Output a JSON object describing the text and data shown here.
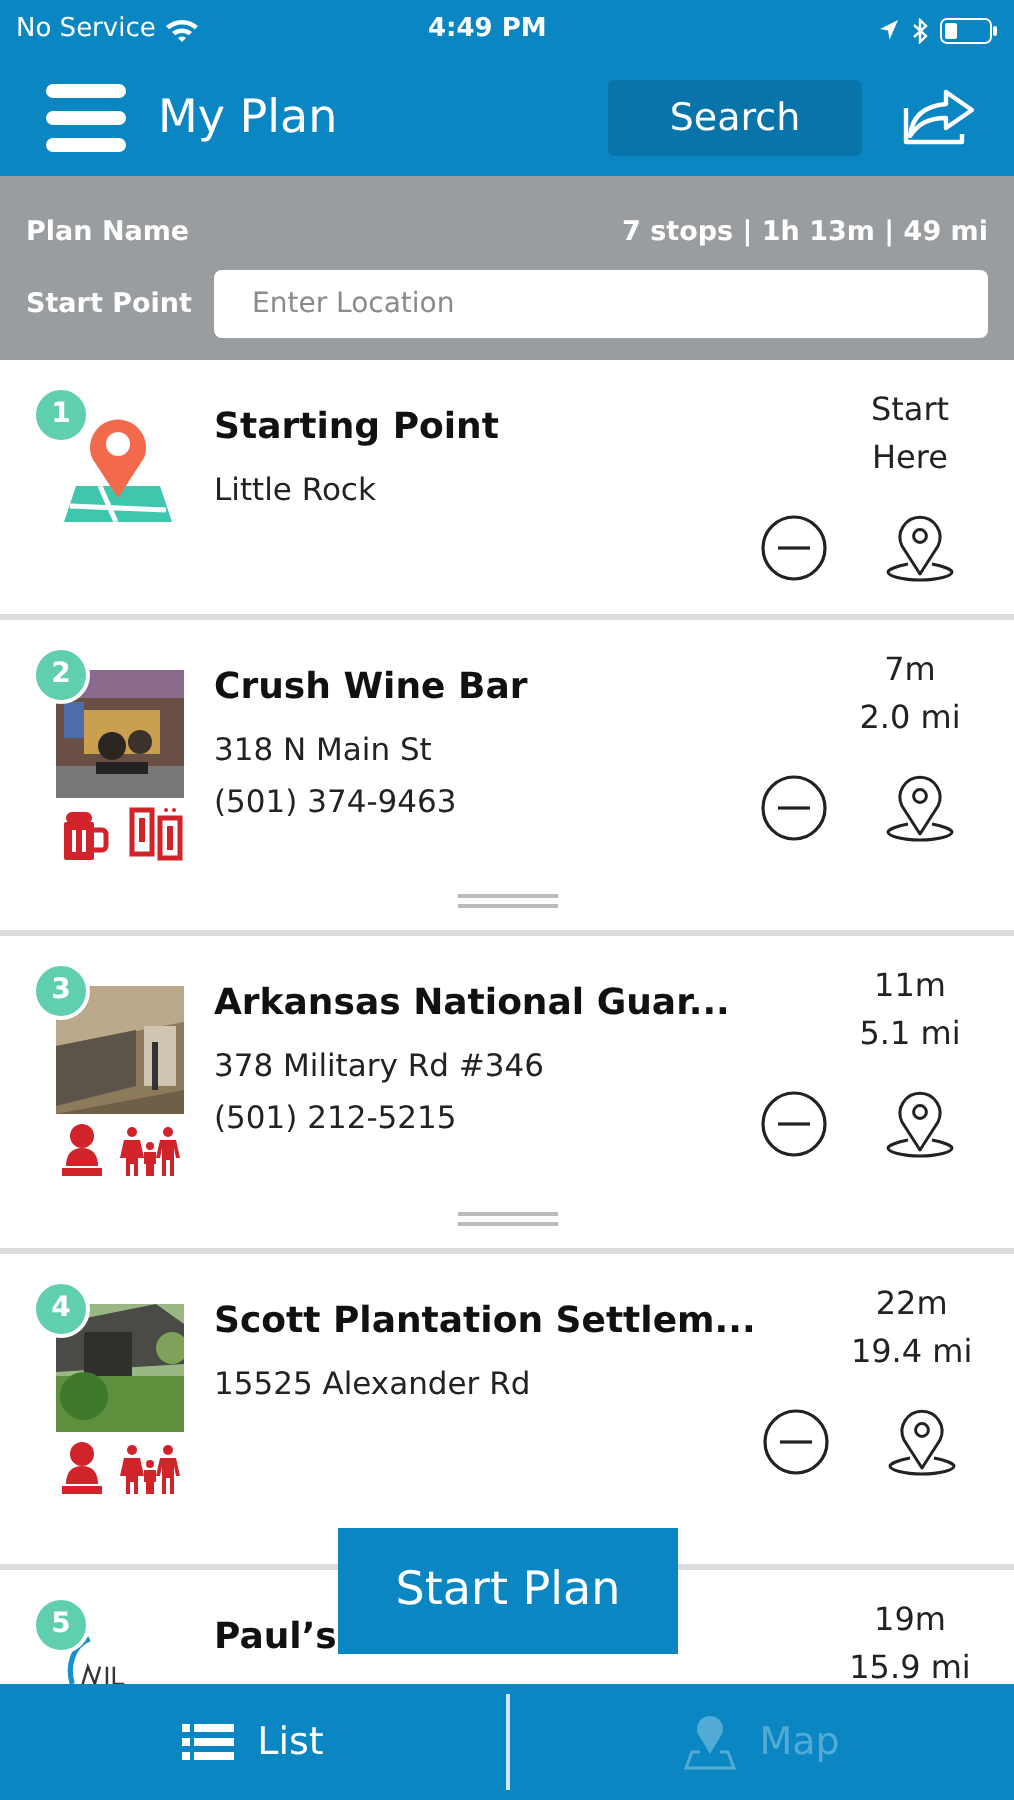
{
  "status_bar": {
    "carrier": "No Service",
    "time": "4:49 PM"
  },
  "header": {
    "title": "My Plan",
    "search_label": "Search"
  },
  "plan": {
    "name_label": "Plan Name",
    "summary": "7 stops | 1h 13m | 49 mi",
    "start_label": "Start Point",
    "start_field": {
      "placeholder": "Enter Location"
    }
  },
  "stops": [
    {
      "number": "1",
      "kind": "start",
      "name": "Starting Point",
      "lines": [
        "Little Rock"
      ],
      "times": [
        "Start",
        "Here"
      ],
      "drag_handle": false
    },
    {
      "number": "2",
      "kind": "place",
      "name": "Crush Wine Bar",
      "lines": [
        "318 N Main St",
        "(501) 374-9463"
      ],
      "times": [
        "7m",
        "2.0 mi"
      ],
      "amenities": [
        {
          "kind": "beer"
        },
        {
          "kind": "drinks"
        }
      ],
      "drag_handle": true,
      "picture": {
        "kind": "picture"
      }
    },
    {
      "number": "3",
      "kind": "place",
      "name": "Arkansas National Guar...",
      "lines": [
        "378 Military Rd #346",
        "(501) 212-5215"
      ],
      "times": [
        "11m",
        "5.1 mi"
      ],
      "amenities": [
        {
          "kind": "museum"
        },
        {
          "kind": "family"
        }
      ],
      "drag_handle": true,
      "picture": {
        "kind": "picture"
      }
    },
    {
      "number": "4",
      "kind": "place",
      "name": "Scott Plantation Settlem...",
      "lines": [
        "15525 Alexander Rd"
      ],
      "times": [
        "22m",
        "19.4 mi"
      ],
      "amenities": [
        {
          "kind": "museum"
        },
        {
          "kind": "family"
        }
      ],
      "drag_handle": false,
      "picture": {
        "kind": "picture"
      }
    },
    {
      "number": "5",
      "kind": "logo",
      "name": "Paul’s",
      "times": [
        "19m",
        "15.9 mi"
      ],
      "drag_handle": false
    }
  ],
  "start_plan_button": "Start Plan",
  "tabs": [
    {
      "label": "List",
      "kind": "list",
      "selected": true
    },
    {
      "label": "Map",
      "kind": "map",
      "selected": false
    }
  ]
}
